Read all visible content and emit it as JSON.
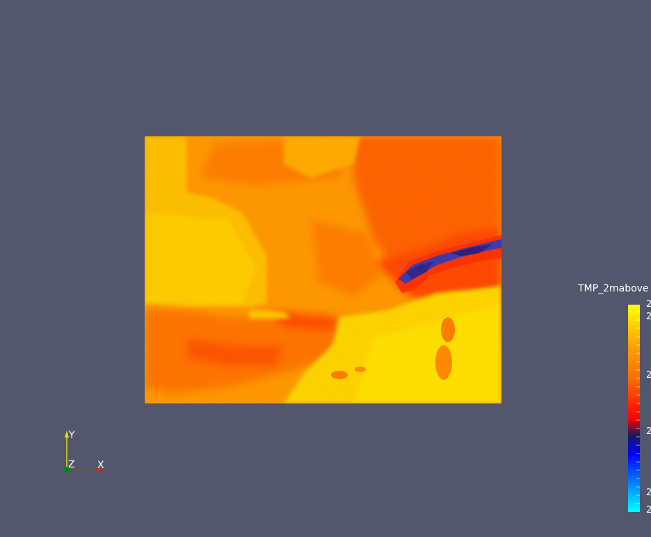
{
  "scalar_bar": {
    "title": "TMP_2mabove",
    "tick_labels": [
      "2",
      "2",
      "2",
      "2",
      "2",
      "2"
    ]
  },
  "axes": {
    "x_label": "X",
    "y_label": "Y",
    "z_label": "Z"
  },
  "colors": {
    "background": "#52576e",
    "colormap": [
      "#00ffff",
      "#0000ff",
      "#1a1a5a",
      "#ff0000",
      "#ff8800",
      "#ffff00"
    ],
    "x_axis": "#e02020",
    "y_axis": "#e0e000",
    "z_axis": "#108010"
  }
}
